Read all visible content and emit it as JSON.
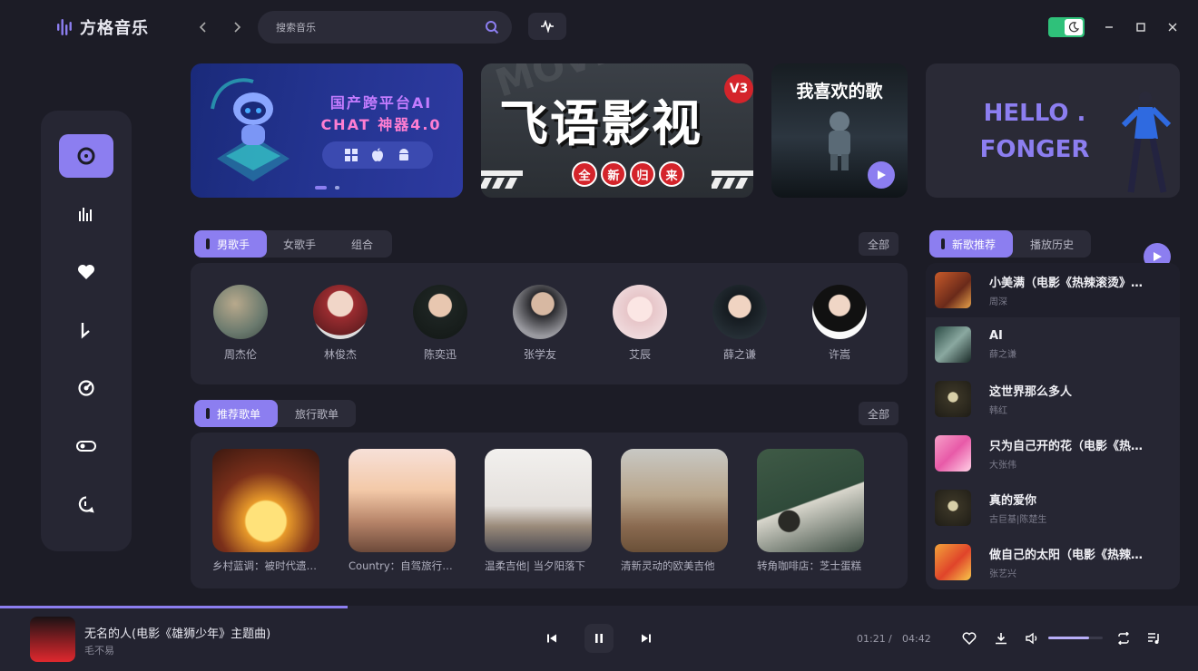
{
  "app": {
    "name": "方格音乐"
  },
  "search": {
    "placeholder": "搜索音乐"
  },
  "colors": {
    "accent": "#8c7ef0",
    "background": "#1c1c26",
    "panel": "#262633",
    "toggle": "#2fc17a"
  },
  "banners": {
    "b1": {
      "line1": "国产跨平台AI",
      "line2": "CHAT 神器4.0"
    },
    "b2": {
      "title": "飞语影视",
      "badge": "V3",
      "tags": [
        "全",
        "新",
        "归",
        "来"
      ],
      "bg_text": "MOVIES"
    },
    "b3": {
      "title": "我喜欢的歌"
    },
    "b4": {
      "line1": "HELLO .",
      "line2": "FONGER"
    }
  },
  "artists": {
    "tabs": [
      "男歌手",
      "女歌手",
      "组合"
    ],
    "all_label": "全部",
    "items": [
      {
        "name": "周杰伦",
        "color": "#6b7a6e"
      },
      {
        "name": "林俊杰",
        "color": "#8a5a5a"
      },
      {
        "name": "陈奕迅",
        "color": "#2d3532"
      },
      {
        "name": "张学友",
        "color": "#4a4a50"
      },
      {
        "name": "艾辰",
        "color": "#e8cfd2"
      },
      {
        "name": "薛之谦",
        "color": "#1e2a30"
      },
      {
        "name": "许嵩",
        "color": "#3a3a3e"
      }
    ]
  },
  "playlists": {
    "tabs": [
      "推荐歌单",
      "旅行歌单"
    ],
    "all_label": "全部",
    "items": [
      {
        "name": "乡村蓝调：被时代遗忘的旋律"
      },
      {
        "name": "Country：自驾旅行路上"
      },
      {
        "name": "温柔吉他| 当夕阳落下"
      },
      {
        "name": "清新灵动的欧美吉他"
      },
      {
        "name": "转角咖啡店：芝士蛋糕"
      }
    ]
  },
  "right": {
    "tabs": [
      "新歌推荐",
      "播放历史"
    ],
    "songs": [
      {
        "title": "小美满（电影《热辣滚烫》主题曲）",
        "artist": "周深"
      },
      {
        "title": "AI",
        "artist": "薛之谦"
      },
      {
        "title": "这世界那么多人",
        "artist": "韩红"
      },
      {
        "title": "只为自己开的花（电影《热辣滚烫》）",
        "artist": "大张伟"
      },
      {
        "title": "真的爱你",
        "artist": "古巨基|陈楚生"
      },
      {
        "title": "做自己的太阳（电影《热辣滚烫》）",
        "artist": "张艺兴"
      }
    ]
  },
  "player": {
    "title": "无名的人(电影《雄狮少年》主题曲)",
    "artist": "毛不易",
    "current": "01:21",
    "separator": "/",
    "total": "04:42",
    "progress": 0.29,
    "volume": 0.75
  }
}
